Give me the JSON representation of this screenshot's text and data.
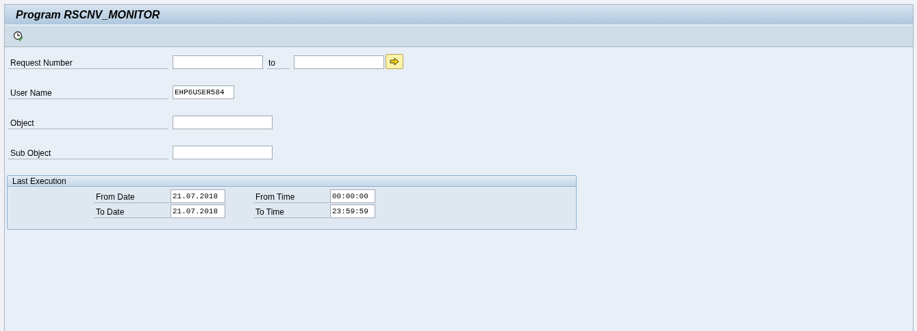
{
  "window": {
    "title": "Program RSCNV_MONITOR"
  },
  "fields": [
    {
      "kind": "range",
      "label": "Request Number",
      "to_label": "to"
    },
    {
      "kind": "short",
      "label": "User Name",
      "value": "EHP6USER584"
    },
    {
      "kind": "long",
      "label": "Object"
    },
    {
      "kind": "long",
      "label": "Sub Object"
    }
  ],
  "group": {
    "title": "Last Execution",
    "rows": [
      [
        {
          "label": "From Date",
          "value": "21.07.2018"
        },
        {
          "label": "From Time",
          "value": "00:00:00"
        }
      ],
      [
        {
          "label": "To Date",
          "value": "21.07.2018"
        },
        {
          "label": "To Time",
          "value": "23:59:59"
        }
      ]
    ]
  }
}
